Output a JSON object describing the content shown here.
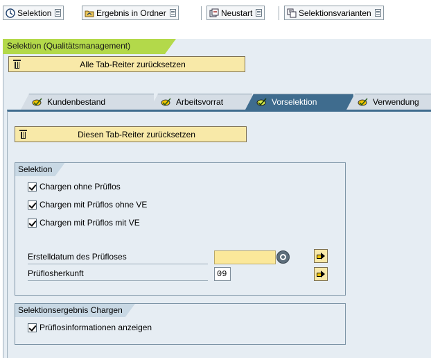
{
  "toolbar": {
    "buttons": [
      {
        "label": "Selektion",
        "icon": "clock-run-icon"
      },
      {
        "label": "Ergebnis in Ordner",
        "icon": "folder-result-icon"
      },
      {
        "label": "Neustart",
        "icon": "restart-icon"
      },
      {
        "label": "Selektionsvarianten",
        "icon": "variants-icon"
      }
    ]
  },
  "header": {
    "title": "Selektion (Qualitätsmanagement)",
    "reset_all_label": "Alle Tab-Reiter zurücksetzen"
  },
  "tabs": [
    {
      "label": "Kundenbestand",
      "active": false
    },
    {
      "label": "Arbeitsvorrat",
      "active": false
    },
    {
      "label": "Vorselektion",
      "active": true
    },
    {
      "label": "Verwendung",
      "active": false
    }
  ],
  "panel": {
    "reset_tab_label": "Diesen Tab-Reiter zurücksetzen",
    "selection_group": {
      "title": "Selektion",
      "checkboxes": [
        {
          "label": "Chargen ohne Prüflos",
          "checked": true
        },
        {
          "label": "Chargen mit Prüflos ohne VE",
          "checked": true
        },
        {
          "label": "Chargen mit Prüflos mit VE",
          "checked": true
        }
      ],
      "fields": [
        {
          "label": "Erstelldatum des Prüfloses",
          "value": ""
        },
        {
          "label": "Prüflosherkunft",
          "value": "09"
        }
      ]
    },
    "result_group": {
      "title": "Selektionsergebnis Chargen",
      "checkboxes": [
        {
          "label": "Prüflosinformationen anzeigen",
          "checked": true
        }
      ]
    }
  },
  "colors": {
    "title_tab": "#b3d94a",
    "active_tab": "#3f6c8e",
    "button_bg": "#f8e9a8",
    "required_field": "#fbe89a"
  }
}
